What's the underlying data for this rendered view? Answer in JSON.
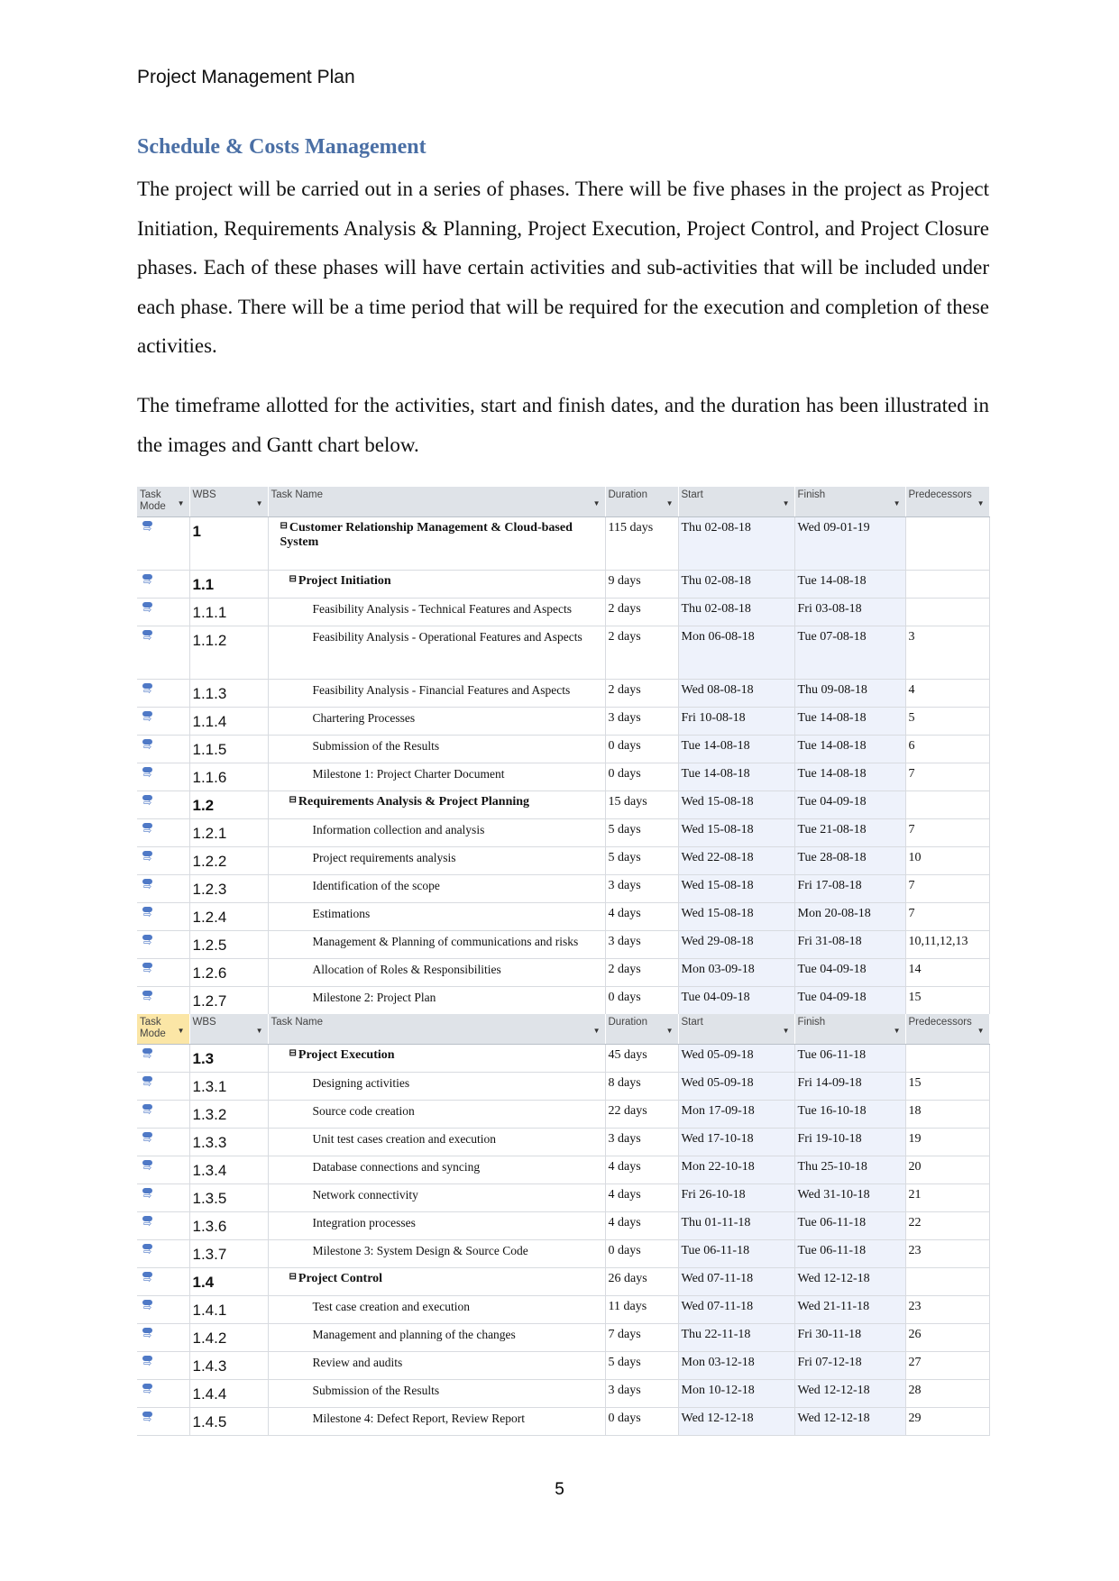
{
  "header": {
    "title": "Project Management Plan"
  },
  "section": {
    "heading": "Schedule & Costs Management",
    "para1": "The project will be carried out in a series of phases. There will be five phases in the project as Project Initiation, Requirements Analysis & Planning, Project Execution, Project Control, and Project Closure phases. Each of these phases will have certain activities and sub-activities that will be included under each phase. There will be a time period that will be required for the execution and completion of these activities.",
    "para2": "The timeframe allotted for the activities, start and finish dates, and the duration has been illustrated in the images and Gantt chart below."
  },
  "columns": [
    "Task Mode",
    "WBS",
    "Task Name",
    "Duration",
    "Start",
    "Finish",
    "Predecessors"
  ],
  "icons": {
    "task_mode": "auto-scheduled-task-icon",
    "dropdown": "dropdown-arrow-icon",
    "collapse": "collapse-minus-icon"
  },
  "table1": [
    {
      "wbs": "1",
      "name": "Customer Relationship Management & Cloud-based System",
      "duration": "115 days",
      "start": "Thu 02-08-18",
      "finish": "Wed 09-01-19",
      "pred": "",
      "level": 0,
      "summary": true,
      "tall": true
    },
    {
      "wbs": "1.1",
      "name": "Project Initiation",
      "duration": "9 days",
      "start": "Thu 02-08-18",
      "finish": "Tue 14-08-18",
      "pred": "",
      "level": 1,
      "summary": true
    },
    {
      "wbs": "1.1.1",
      "name": "Feasibility Analysis - Technical Features and Aspects",
      "duration": "2 days",
      "start": "Thu 02-08-18",
      "finish": "Fri 03-08-18",
      "pred": "",
      "level": 2
    },
    {
      "wbs": "1.1.2",
      "name": "Feasibility Analysis - Operational Features and Aspects",
      "duration": "2 days",
      "start": "Mon 06-08-18",
      "finish": "Tue 07-08-18",
      "pred": "3",
      "level": 2,
      "tall": true
    },
    {
      "wbs": "1.1.3",
      "name": "Feasibility Analysis - Financial Features and Aspects",
      "duration": "2 days",
      "start": "Wed 08-08-18",
      "finish": "Thu 09-08-18",
      "pred": "4",
      "level": 2
    },
    {
      "wbs": "1.1.4",
      "name": "Chartering Processes",
      "duration": "3 days",
      "start": "Fri 10-08-18",
      "finish": "Tue 14-08-18",
      "pred": "5",
      "level": 2
    },
    {
      "wbs": "1.1.5",
      "name": "Submission of the Results",
      "duration": "0 days",
      "start": "Tue 14-08-18",
      "finish": "Tue 14-08-18",
      "pred": "6",
      "level": 2
    },
    {
      "wbs": "1.1.6",
      "name": "Milestone 1: Project Charter Document",
      "duration": "0 days",
      "start": "Tue 14-08-18",
      "finish": "Tue 14-08-18",
      "pred": "7",
      "level": 2
    },
    {
      "wbs": "1.2",
      "name": "Requirements Analysis & Project Planning",
      "duration": "15 days",
      "start": "Wed 15-08-18",
      "finish": "Tue 04-09-18",
      "pred": "",
      "level": 1,
      "summary": true
    },
    {
      "wbs": "1.2.1",
      "name": "Information collection and analysis",
      "duration": "5 days",
      "start": "Wed 15-08-18",
      "finish": "Tue 21-08-18",
      "pred": "7",
      "level": 2
    },
    {
      "wbs": "1.2.2",
      "name": "Project requirements analysis",
      "duration": "5 days",
      "start": "Wed 22-08-18",
      "finish": "Tue 28-08-18",
      "pred": "10",
      "level": 2
    },
    {
      "wbs": "1.2.3",
      "name": "Identification of the scope",
      "duration": "3 days",
      "start": "Wed 15-08-18",
      "finish": "Fri 17-08-18",
      "pred": "7",
      "level": 2
    },
    {
      "wbs": "1.2.4",
      "name": "Estimations",
      "duration": "4 days",
      "start": "Wed 15-08-18",
      "finish": "Mon 20-08-18",
      "pred": "7",
      "level": 2
    },
    {
      "wbs": "1.2.5",
      "name": "Management & Planning of communications and risks",
      "duration": "3 days",
      "start": "Wed 29-08-18",
      "finish": "Fri 31-08-18",
      "pred": "10,11,12,13",
      "level": 2
    },
    {
      "wbs": "1.2.6",
      "name": "Allocation of Roles & Responsibilities",
      "duration": "2 days",
      "start": "Mon 03-09-18",
      "finish": "Tue 04-09-18",
      "pred": "14",
      "level": 2
    },
    {
      "wbs": "1.2.7",
      "name": "Milestone 2: Project Plan",
      "duration": "0 days",
      "start": "Tue 04-09-18",
      "finish": "Tue 04-09-18",
      "pred": "15",
      "level": 2
    }
  ],
  "table2": [
    {
      "wbs": "1.3",
      "name": "Project Execution",
      "duration": "45 days",
      "start": "Wed 05-09-18",
      "finish": "Tue 06-11-18",
      "pred": "",
      "level": 1,
      "summary": true
    },
    {
      "wbs": "1.3.1",
      "name": "Designing activities",
      "duration": "8 days",
      "start": "Wed 05-09-18",
      "finish": "Fri 14-09-18",
      "pred": "15",
      "level": 2
    },
    {
      "wbs": "1.3.2",
      "name": "Source code creation",
      "duration": "22 days",
      "start": "Mon 17-09-18",
      "finish": "Tue 16-10-18",
      "pred": "18",
      "level": 2
    },
    {
      "wbs": "1.3.3",
      "name": "Unit test cases creation and execution",
      "duration": "3 days",
      "start": "Wed 17-10-18",
      "finish": "Fri 19-10-18",
      "pred": "19",
      "level": 2
    },
    {
      "wbs": "1.3.4",
      "name": "Database connections and syncing",
      "duration": "4 days",
      "start": "Mon 22-10-18",
      "finish": "Thu 25-10-18",
      "pred": "20",
      "level": 2
    },
    {
      "wbs": "1.3.5",
      "name": "Network connectivity",
      "duration": "4 days",
      "start": "Fri 26-10-18",
      "finish": "Wed 31-10-18",
      "pred": "21",
      "level": 2
    },
    {
      "wbs": "1.3.6",
      "name": "Integration processes",
      "duration": "4 days",
      "start": "Thu 01-11-18",
      "finish": "Tue 06-11-18",
      "pred": "22",
      "level": 2
    },
    {
      "wbs": "1.3.7",
      "name": "Milestone 3: System Design & Source Code",
      "duration": "0 days",
      "start": "Tue 06-11-18",
      "finish": "Tue 06-11-18",
      "pred": "23",
      "level": 2
    },
    {
      "wbs": "1.4",
      "name": "Project Control",
      "duration": "26 days",
      "start": "Wed 07-11-18",
      "finish": "Wed 12-12-18",
      "pred": "",
      "level": 1,
      "summary": true
    },
    {
      "wbs": "1.4.1",
      "name": "Test case creation and execution",
      "duration": "11 days",
      "start": "Wed 07-11-18",
      "finish": "Wed 21-11-18",
      "pred": "23",
      "level": 2
    },
    {
      "wbs": "1.4.2",
      "name": "Management and planning of the changes",
      "duration": "7 days",
      "start": "Thu 22-11-18",
      "finish": "Fri 30-11-18",
      "pred": "26",
      "level": 2
    },
    {
      "wbs": "1.4.3",
      "name": "Review and audits",
      "duration": "5 days",
      "start": "Mon 03-12-18",
      "finish": "Fri 07-12-18",
      "pred": "27",
      "level": 2
    },
    {
      "wbs": "1.4.4",
      "name": "Submission of the Results",
      "duration": "3 days",
      "start": "Mon 10-12-18",
      "finish": "Wed 12-12-18",
      "pred": "28",
      "level": 2
    },
    {
      "wbs": "1.4.5",
      "name": "Milestone 4: Defect Report, Review Report",
      "duration": "0 days",
      "start": "Wed 12-12-18",
      "finish": "Wed 12-12-18",
      "pred": "29",
      "level": 2
    }
  ],
  "footer": {
    "page_number": "5"
  }
}
